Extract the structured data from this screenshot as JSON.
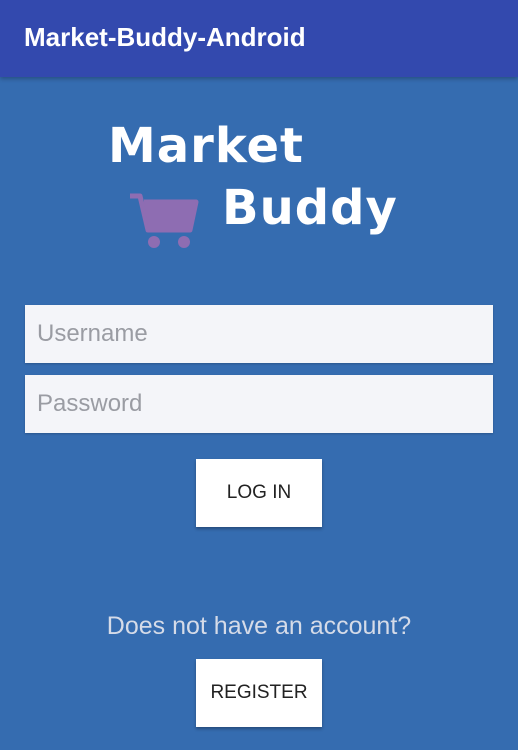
{
  "app_bar": {
    "title": "Market-Buddy-Android"
  },
  "logo": {
    "line1": "Market",
    "line2": "Buddy",
    "icon": "shopping-cart-icon",
    "icon_color": "#8e6db2"
  },
  "form": {
    "username_placeholder": "Username",
    "password_placeholder": "Password",
    "login_label": "LOG IN"
  },
  "register": {
    "prompt": "Does not have an account?",
    "button_label": "REGISTER"
  },
  "colors": {
    "app_bar": "#3349ae",
    "background": "#356cb0",
    "field_bg": "#f4f5f9"
  }
}
